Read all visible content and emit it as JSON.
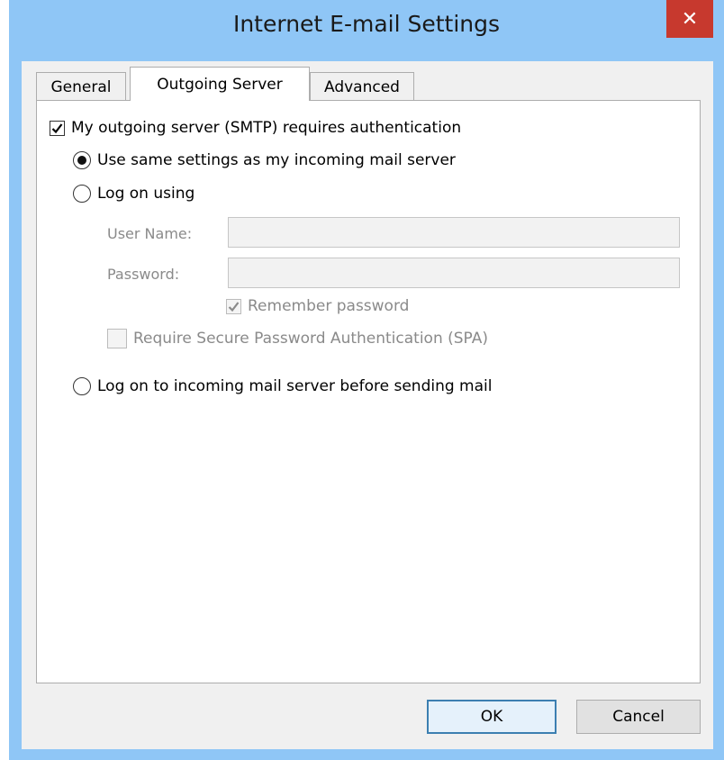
{
  "window": {
    "title": "Internet E-mail Settings",
    "close_glyph": "✕"
  },
  "tabs": [
    {
      "label": "General",
      "active": false
    },
    {
      "label": "Outgoing Server",
      "active": true
    },
    {
      "label": "Advanced",
      "active": false
    }
  ],
  "auth_checkbox": {
    "label": "My outgoing server (SMTP) requires authentication",
    "checked": true
  },
  "options": {
    "same_settings": {
      "label": "Use same settings as my incoming mail server",
      "selected": true
    },
    "log_on_using": {
      "label": "Log on using",
      "selected": false
    },
    "log_on_incoming": {
      "label": "Log on to incoming mail server before sending mail",
      "selected": false
    }
  },
  "credentials": {
    "username_label": "User Name:",
    "username_value": "",
    "password_label": "Password:",
    "password_value": "",
    "remember_password": {
      "label": "Remember password",
      "checked": true
    },
    "spa": {
      "label": "Require Secure Password Authentication (SPA)",
      "checked": false
    }
  },
  "buttons": {
    "ok": "OK",
    "cancel": "Cancel"
  },
  "colors": {
    "titlebar": "#8fc6f6",
    "close": "#c7392e",
    "default_button_border": "#3c7fb1"
  },
  "icons": {
    "check": "checkmark-icon",
    "close": "close-icon"
  }
}
